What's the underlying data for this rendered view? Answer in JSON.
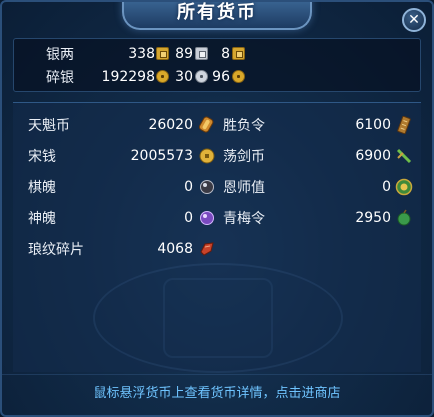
{
  "window": {
    "title": "所有货币",
    "close_label": "✕"
  },
  "top": {
    "row1": {
      "label": "银两",
      "a": "338",
      "b": "89",
      "c": "8"
    },
    "row2": {
      "label": "碎银",
      "a": "192298",
      "b": "30",
      "c": "96"
    }
  },
  "currencies": [
    {
      "label": "天魁币",
      "value": "26020",
      "icon": "scroll-coin-icon"
    },
    {
      "label": "胜负令",
      "value": "6100",
      "icon": "token-plaque-icon"
    },
    {
      "label": "宋钱",
      "value": "2005573",
      "icon": "gold-coin-icon"
    },
    {
      "label": "荡剑币",
      "value": "6900",
      "icon": "green-sword-icon"
    },
    {
      "label": "棋魄",
      "value": "0",
      "icon": "chess-stone-icon"
    },
    {
      "label": "恩师值",
      "value": "0",
      "icon": "green-gold-medal-icon"
    },
    {
      "label": "神魄",
      "value": "0",
      "icon": "purple-orb-icon"
    },
    {
      "label": "青梅令",
      "value": "2950",
      "icon": "green-plum-icon"
    },
    {
      "label": "琅纹碎片",
      "value": "4068",
      "icon": "red-fragment-icon"
    }
  ],
  "footer": {
    "hint": "鼠标悬浮货币上查看货币详情，点击进商店"
  },
  "colors": {
    "accent_link": "#6fc4ff",
    "panel_bg": "#112b48",
    "border": "#2b4f7a"
  }
}
